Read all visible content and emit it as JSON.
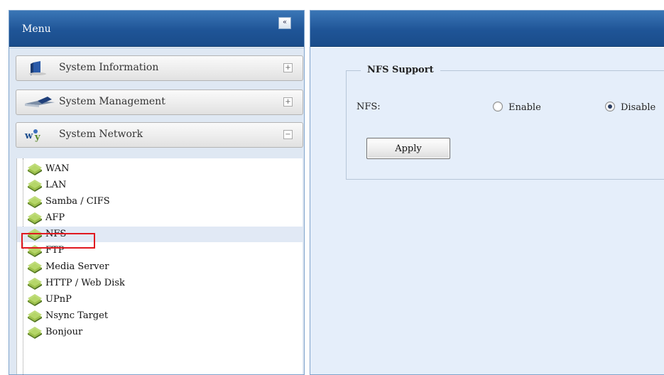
{
  "menu": {
    "title": "Menu",
    "collapse_icon": "«",
    "sections": [
      {
        "label": "System Information",
        "icon": "info-book-icon",
        "toggle": "+"
      },
      {
        "label": "System Management",
        "icon": "wrench-icon",
        "toggle": "+"
      },
      {
        "label": "System Network",
        "icon": "network-icon",
        "toggle": "−"
      }
    ],
    "network_items": [
      {
        "label": "WAN"
      },
      {
        "label": "LAN"
      },
      {
        "label": "Samba / CIFS"
      },
      {
        "label": "AFP"
      },
      {
        "label": "NFS",
        "selected": true
      },
      {
        "label": "FTP"
      },
      {
        "label": "Media Server"
      },
      {
        "label": "HTTP / Web Disk"
      },
      {
        "label": "UPnP"
      },
      {
        "label": "Nsync Target"
      },
      {
        "label": "Bonjour"
      }
    ]
  },
  "content": {
    "fieldset_title": "NFS Support",
    "nfs_label": "NFS:",
    "options": [
      {
        "label": "Enable",
        "checked": false
      },
      {
        "label": "Disable",
        "checked": true
      }
    ],
    "apply_label": "Apply"
  },
  "colors": {
    "header_blue": "#1f5597",
    "content_bg": "#e5eefa",
    "highlight_red": "#e0191f",
    "leaf_green": "#7da23a"
  }
}
